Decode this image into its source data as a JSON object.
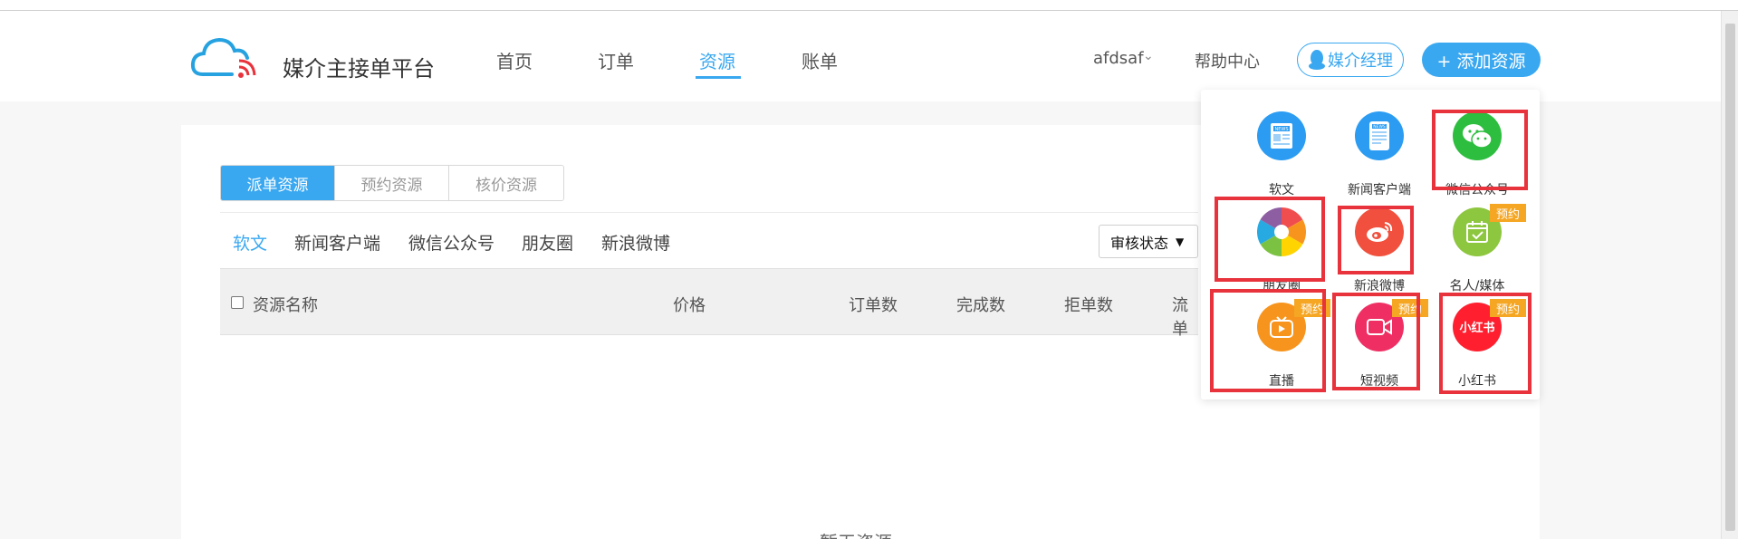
{
  "brand": {
    "name": "媒介主接单平台"
  },
  "nav": [
    "首页",
    "订单",
    "资源",
    "账单"
  ],
  "nav_active": "资源",
  "header_right": {
    "user": "afdsaf",
    "help": "帮助中心",
    "manager_button": "媒介经理",
    "add_button": "+ 添加资源"
  },
  "resource_tabs": [
    "派单资源",
    "预约资源",
    "核价资源"
  ],
  "resource_tab_active": "派单资源",
  "categories": [
    "软文",
    "新闻客户端",
    "微信公众号",
    "朋友圈",
    "新浪微博"
  ],
  "category_active": "软文",
  "status_filter": {
    "selected": "审核状态"
  },
  "table": {
    "headers": [
      "资源名称",
      "价格",
      "订单数",
      "完成数",
      "拒单数",
      "流单"
    ]
  },
  "empty_text": "暂无资源",
  "add_popup": {
    "items": [
      {
        "label": "软文",
        "icon": "news-icon",
        "color": "#2b9cf2",
        "badge": ""
      },
      {
        "label": "新闻客户端",
        "icon": "news-tablet-icon",
        "color": "#2b9cf2",
        "badge": ""
      },
      {
        "label": "微信公众号",
        "icon": "wechat-icon",
        "color": "#2dbe3f",
        "badge": ""
      },
      {
        "label": "朋友圈",
        "icon": "moments-aperture-icon",
        "color": "#ffffff",
        "badge": ""
      },
      {
        "label": "新浪微博",
        "icon": "weibo-icon",
        "color": "#f0503d",
        "badge": ""
      },
      {
        "label": "名人/媒体",
        "icon": "calendar-check-icon",
        "color": "#8dc63f",
        "badge": "预约"
      },
      {
        "label": "直播",
        "icon": "live-tv-icon",
        "color": "#f7941d",
        "badge": "预约"
      },
      {
        "label": "短视频",
        "icon": "video-camera-icon",
        "color": "#ef2f63",
        "badge": "预约"
      },
      {
        "label": "小红书",
        "icon": "xiaohongshu-icon",
        "color": "#ff1f2f",
        "badge": "预约"
      }
    ],
    "highlight_color": "#e8323c"
  }
}
